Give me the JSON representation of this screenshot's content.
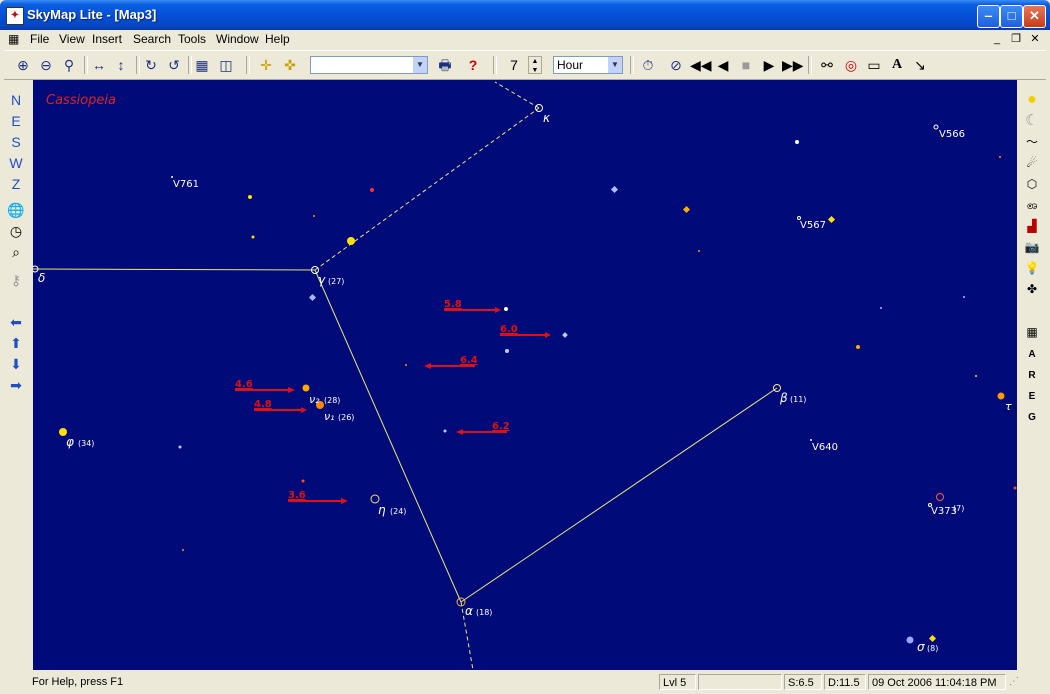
{
  "window": {
    "title": "SkyMap Lite - [Map3]"
  },
  "menu": [
    "File",
    "View",
    "Insert",
    "Search",
    "Tools",
    "Window",
    "Help"
  ],
  "toolbar": {
    "search_value": "",
    "step_value": "7",
    "unit_value": "Hour"
  },
  "left_toolbar": {
    "directions": [
      "N",
      "E",
      "S",
      "W",
      "Z"
    ]
  },
  "right_toolbar": {
    "letters": [
      "A",
      "R",
      "E",
      "G"
    ]
  },
  "map": {
    "constellation_name": "Cassiopeia",
    "star_labels": [
      {
        "text": "κ"
      },
      {
        "text": "V566"
      },
      {
        "text": "V761"
      },
      {
        "text": "V567"
      },
      {
        "text": "δ"
      },
      {
        "text": "γ"
      },
      {
        "text": "(27)"
      },
      {
        "text": "β"
      },
      {
        "text": "(11)"
      },
      {
        "text": "ν₂"
      },
      {
        "text": "(28)"
      },
      {
        "text": "ν₁"
      },
      {
        "text": "(26)"
      },
      {
        "text": "φ"
      },
      {
        "text": "(34)"
      },
      {
        "text": "V640"
      },
      {
        "text": "τ"
      },
      {
        "text": "η"
      },
      {
        "text": "(24)"
      },
      {
        "text": "V373"
      },
      {
        "text": "(7)"
      },
      {
        "text": "α"
      },
      {
        "text": "(18)"
      },
      {
        "text": "σ"
      },
      {
        "text": "(8)"
      }
    ],
    "magnitude_labels": [
      "5.8",
      "6.0",
      "6.4",
      "4.6",
      "4.8",
      "6.2",
      "3.6"
    ]
  },
  "status": {
    "help": "For Help, press F1",
    "level": "Lvl 5",
    "blank": "",
    "s": "S:6.5",
    "d": "D:11.5",
    "datetime": "09 Oct 2006 11:04:18 PM"
  },
  "colors": {
    "sky": "#000a78",
    "line": "#e8e87a",
    "annotation": "#e01010",
    "constellation_label": "#e02020"
  }
}
